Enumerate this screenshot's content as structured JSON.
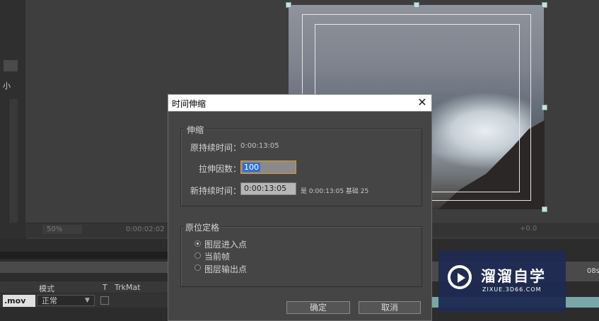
{
  "background": {
    "left_panel_label": "小",
    "zoom_value": "50%",
    "time_value": "0:00:02:02",
    "exposure_value": "+0.0",
    "timeline": {
      "columns": {
        "mode": "模式",
        "t": "T",
        "trkmat": "TrkMat"
      },
      "layer_name": ".mov",
      "mode_value": "正常",
      "ruler_label": "08s"
    }
  },
  "watermark": {
    "title": "溜溜自学",
    "url": "ZIXUE.3D66.COM"
  },
  "dialog": {
    "title": "时间伸缩",
    "close_glyph": "✕",
    "stretch_group": {
      "label": "伸缩",
      "original_duration_label": "原持续时间：",
      "original_duration_value": "0:00:13:05",
      "stretch_factor_label": "拉伸因数：",
      "stretch_factor_value": "100",
      "new_duration_label": "新持续时间：",
      "new_duration_value": "0:00:13:05",
      "is_text": "是 0:00:13:05  基础 25"
    },
    "hold_group": {
      "label": "原位定格",
      "options": [
        "图层进入点",
        "当前帧",
        "图层输出点"
      ],
      "selected_index": 0
    },
    "ok_label": "确定",
    "cancel_label": "取消"
  }
}
